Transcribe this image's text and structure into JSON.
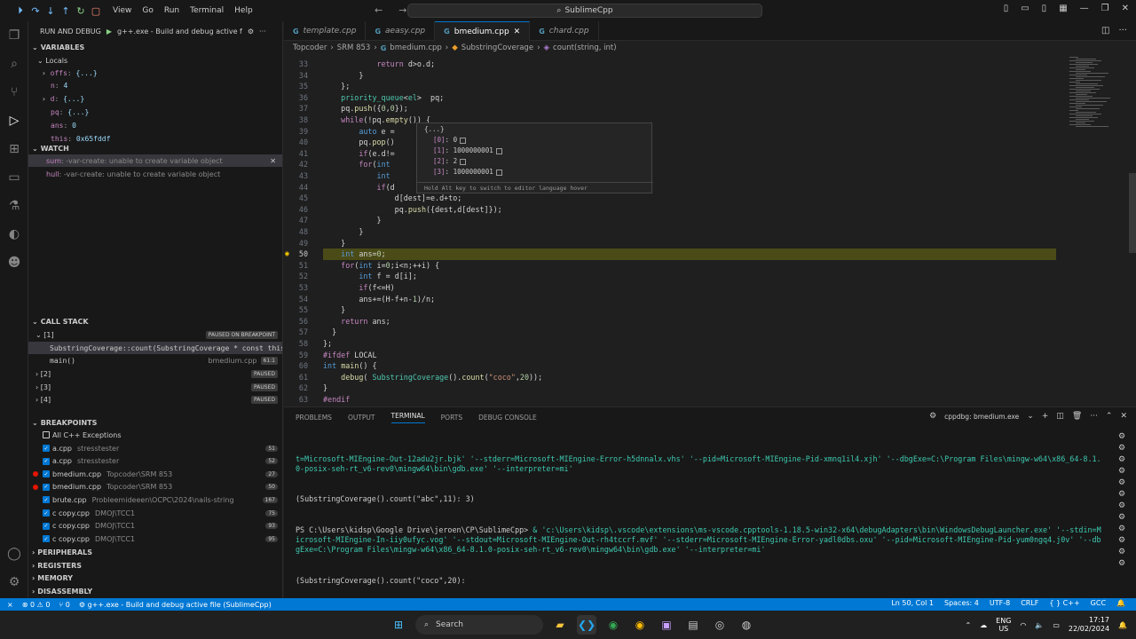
{
  "titlebar": {
    "menus": [
      "View",
      "Go",
      "Run",
      "Terminal",
      "Help"
    ],
    "command_center": "SublimeCpp"
  },
  "sidebar": {
    "header": "RUN AND DEBUG",
    "config": "g++.exe - Build and debug active f",
    "variables_title": "VARIABLES",
    "locals_title": "Locals",
    "locals": [
      {
        "name": "offs",
        "value": "{...}",
        "expandable": true
      },
      {
        "name": "n",
        "value": "4",
        "expandable": false
      },
      {
        "name": "d",
        "value": "{...}",
        "expandable": true
      },
      {
        "name": "pq",
        "value": "{...}",
        "expandable": false
      },
      {
        "name": "ans",
        "value": "0",
        "expandable": false
      },
      {
        "name": "this",
        "value": "0x65fddf",
        "expandable": false
      }
    ],
    "watch_title": "WATCH",
    "watch": [
      {
        "name": "sum",
        "value": "-var-create: unable to create variable object"
      },
      {
        "name": "hull",
        "value": "-var-create: unable to create variable object"
      }
    ],
    "callstack_title": "CALL STACK",
    "callstack": [
      {
        "label": "[1]",
        "badge": "PAUSED ON BREAKPOINT"
      },
      {
        "label": "SubstringCoverage::count(SubstringCoverage * const this",
        "badge": ""
      },
      {
        "label": "main()",
        "file": "bmedium.cpp",
        "line": "61:1"
      },
      {
        "label": "[2]",
        "badge": "PAUSED"
      },
      {
        "label": "[3]",
        "badge": "PAUSED"
      },
      {
        "label": "[4]",
        "badge": "PAUSED"
      }
    ],
    "breakpoints_title": "BREAKPOINTS",
    "exceptions_label": "All C++ Exceptions",
    "breakpoints": [
      {
        "file": "a.cpp",
        "path": "stresstester",
        "line": "51",
        "dot": false
      },
      {
        "file": "a.cpp",
        "path": "stresstester",
        "line": "52",
        "dot": false
      },
      {
        "file": "bmedium.cpp",
        "path": "Topcoder\\SRM 853",
        "line": "27",
        "dot": true
      },
      {
        "file": "bmedium.cpp",
        "path": "Topcoder\\SRM 853",
        "line": "50",
        "dot": true
      },
      {
        "file": "brute.cpp",
        "path": "Probleemideeen\\OCPC\\2024\\nails-string",
        "line": "167",
        "dot": false
      },
      {
        "file": "c copy.cpp",
        "path": "DMOJ\\TCC1",
        "line": "75",
        "dot": false
      },
      {
        "file": "c copy.cpp",
        "path": "DMOJ\\TCC1",
        "line": "93",
        "dot": false
      },
      {
        "file": "c copy.cpp",
        "path": "DMOJ\\TCC1",
        "line": "95",
        "dot": false
      }
    ],
    "extra_sections": [
      "PERIPHERALS",
      "REGISTERS",
      "MEMORY",
      "DISASSEMBLY"
    ]
  },
  "tabs": [
    {
      "label": "template.cpp",
      "active": false
    },
    {
      "label": "aeasy.cpp",
      "active": false
    },
    {
      "label": "bmedium.cpp",
      "active": true
    },
    {
      "label": "chard.cpp",
      "active": false
    }
  ],
  "breadcrumb": [
    "Topcoder",
    "SRM 853",
    "bmedium.cpp",
    "SubstringCoverage",
    "count(string, int)"
  ],
  "editor": {
    "lines": [
      {
        "n": "33",
        "code": "            return d>o.d;"
      },
      {
        "n": "34",
        "code": "        }"
      },
      {
        "n": "35",
        "code": "    };"
      },
      {
        "n": "36",
        "code": "    priority_queue<el>  pq;"
      },
      {
        "n": "37",
        "code": "    pq.push({0,0});"
      },
      {
        "n": "38",
        "code": "    while(!pq.empty()) {"
      },
      {
        "n": "39",
        "code": "        auto e = "
      },
      {
        "n": "40",
        "code": "        pq.pop()"
      },
      {
        "n": "41",
        "code": "        if(e.d!="
      },
      {
        "n": "42",
        "code": "        for(int "
      },
      {
        "n": "43",
        "code": "            int "
      },
      {
        "n": "44",
        "code": "            if(d"
      },
      {
        "n": "45",
        "code": "                d[dest]=e.d+to;"
      },
      {
        "n": "46",
        "code": "                pq.push({dest,d[dest]});"
      },
      {
        "n": "47",
        "code": "            }"
      },
      {
        "n": "48",
        "code": "        }"
      },
      {
        "n": "49",
        "code": "    }"
      },
      {
        "n": "50",
        "code": "    int ans=0;"
      },
      {
        "n": "51",
        "code": "    for(int i=0;i<n;++i) {"
      },
      {
        "n": "52",
        "code": "        int f = d[i];"
      },
      {
        "n": "53",
        "code": "        if(f<=H)"
      },
      {
        "n": "54",
        "code": "        ans+=(H-f+n-1)/n;"
      },
      {
        "n": "55",
        "code": "    }"
      },
      {
        "n": "56",
        "code": "    return ans;"
      },
      {
        "n": "57",
        "code": "  }"
      },
      {
        "n": "58",
        "code": "};"
      },
      {
        "n": "59",
        "code": "#ifdef LOCAL"
      },
      {
        "n": "60",
        "code": "int main() {"
      },
      {
        "n": "61",
        "code": "    debug( SubstringCoverage().count(\"coco\",20));"
      },
      {
        "n": "62",
        "code": "}"
      },
      {
        "n": "63",
        "code": "#endif"
      }
    ],
    "current_line": "50"
  },
  "hover": {
    "header": "{...}",
    "items": [
      {
        "key": "[0]",
        "value": "0"
      },
      {
        "key": "[1]",
        "value": "1000000001"
      },
      {
        "key": "[2]",
        "value": "2"
      },
      {
        "key": "[3]",
        "value": "1000000001"
      }
    ],
    "footer": "Hold Alt key to switch to editor language hover"
  },
  "panel": {
    "tabs": [
      "PROBLEMS",
      "OUTPUT",
      "TERMINAL",
      "PORTS",
      "DEBUG CONSOLE"
    ],
    "active_tab": "TERMINAL",
    "terminal_name": "cppdbg: bmedium.exe",
    "terminal": {
      "line1": "t=Microsoft-MIEngine-Out-12adu2jr.bjk' '--stderr=Microsoft-MIEngine-Error-h5dnnalx.vhs' '--pid=Microsoft-MIEngine-Pid-xmnq1il4.xjh' '--dbgExe=C:\\Program Files\\mingw-w64\\x86_64-8.1.0-posix-seh-rt_v6-rev0\\mingw64\\bin\\gdb.exe' '--interpreter=mi'",
      "line2": "(SubstringCoverage().count(\"abc\",11): 3)",
      "prompt": "PS C:\\Users\\kidsp\\Google Drive\\jeroen\\CP\\SublimeCpp>",
      "cmd": "& 'c:\\Users\\kidsp\\.vscode\\extensions\\ms-vscode.cpptools-1.18.5-win32-x64\\debugAdapters\\bin\\WindowsDebugLauncher.exe' '--stdin=Microsoft-MIEngine-In-iiy0ufyc.vog' '--stdout=Microsoft-MIEngine-Out-rh4tccrf.mvf' '--stderr=Microsoft-MIEngine-Error-yadl0dbs.oxu' '--pid=Microsoft-MIEngine-Pid-yum0ngq4.j0v' '--dbgExe=C:\\Program Files\\mingw-w64\\x86_64-8.1.0-posix-seh-rt_v6-rev0\\mingw64\\bin\\gdb.exe' '--interpreter=mi'",
      "line3": "(SubstringCoverage().count(\"coco\",20):"
    }
  },
  "statusbar": {
    "errors": "0",
    "warnings": "0",
    "ports": "0",
    "debug_config": "g++.exe - Build and debug active file (SublimeCpp)",
    "position": "Ln 50, Col 1",
    "spaces": "Spaces: 4",
    "encoding": "UTF-8",
    "eol": "CRLF",
    "lang": "C++",
    "compiler": "GCC"
  },
  "taskbar": {
    "search": "Search",
    "lang1": "ENG",
    "lang2": "US",
    "time": "17:17",
    "date": "22/02/2024"
  },
  "colors": {
    "accent": "#0078d4",
    "current_line": "#4b4b18",
    "breakpoint": "#e51400"
  }
}
